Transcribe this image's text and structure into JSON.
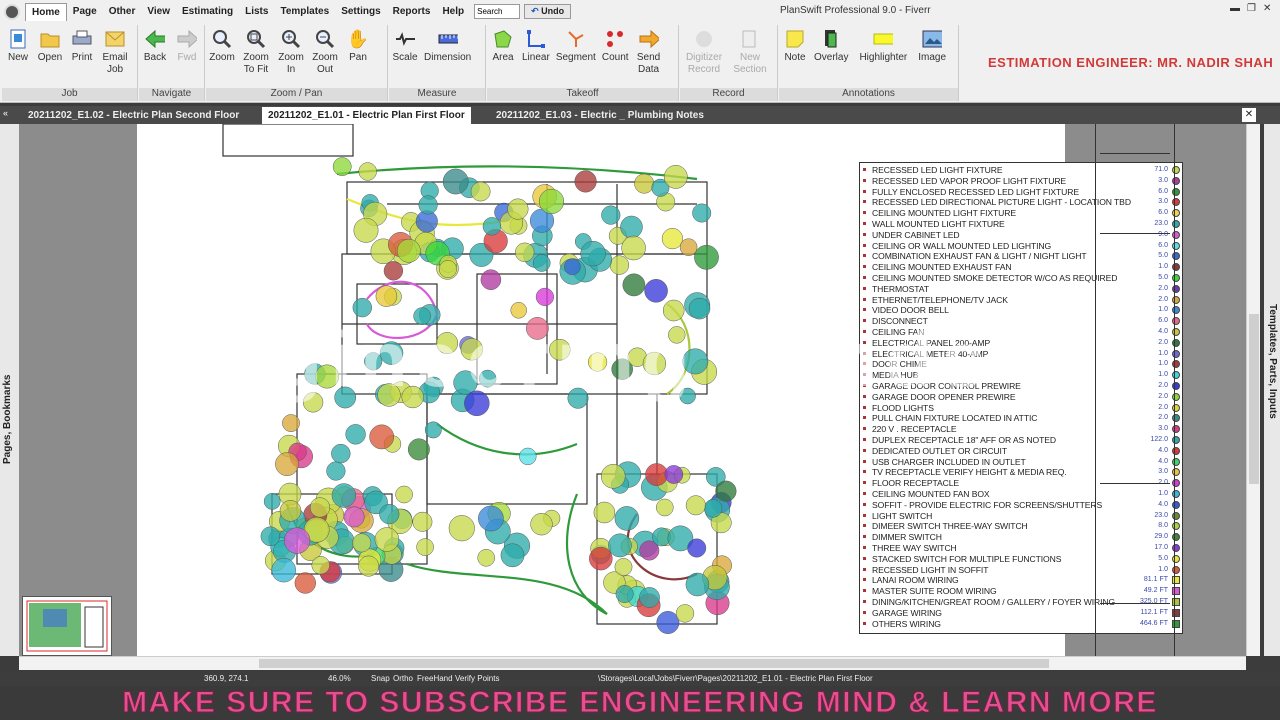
{
  "menu": {
    "items": [
      "Home",
      "Page",
      "Other",
      "View",
      "Estimating",
      "Lists",
      "Templates",
      "Settings",
      "Reports",
      "Help"
    ],
    "search_value": "Search",
    "undo_label": "Undo"
  },
  "window": {
    "title": "PlanSwift Professional 9.0 - Fiverr"
  },
  "ribbon": {
    "groups": [
      {
        "label": "Job",
        "buttons": [
          {
            "label": "New",
            "icon": "new-file-icon"
          },
          {
            "label": "Open",
            "icon": "folder-open-icon"
          },
          {
            "label": "Print",
            "icon": "printer-icon"
          },
          {
            "label": "Email Job",
            "icon": "email-icon"
          }
        ]
      },
      {
        "label": "Navigate",
        "buttons": [
          {
            "label": "Back",
            "icon": "arrow-left-icon"
          },
          {
            "label": "Fwd",
            "icon": "arrow-right-icon",
            "disabled": true
          }
        ]
      },
      {
        "label": "Zoom / Pan",
        "buttons": [
          {
            "label": "Zoom",
            "icon": "zoom-icon"
          },
          {
            "label": "Zoom To Fit",
            "icon": "zoom-fit-icon"
          },
          {
            "label": "Zoom In",
            "icon": "zoom-in-icon"
          },
          {
            "label": "Zoom Out",
            "icon": "zoom-out-icon"
          },
          {
            "label": "Pan",
            "icon": "hand-icon"
          }
        ]
      },
      {
        "label": "Measure",
        "buttons": [
          {
            "label": "Scale",
            "icon": "scale-icon"
          },
          {
            "label": "Dimension",
            "icon": "dimension-icon"
          }
        ]
      },
      {
        "label": "Takeoff",
        "buttons": [
          {
            "label": "Area",
            "icon": "area-icon"
          },
          {
            "label": "Linear",
            "icon": "linear-icon"
          },
          {
            "label": "Segment",
            "icon": "segment-icon"
          },
          {
            "label": "Count",
            "icon": "count-icon"
          },
          {
            "label": "Send Data",
            "icon": "send-data-icon"
          }
        ]
      },
      {
        "label": "Record",
        "buttons": [
          {
            "label": "Digitizer Record",
            "icon": "digitizer-icon",
            "disabled": true
          },
          {
            "label": "New Section",
            "icon": "new-section-icon",
            "disabled": true
          }
        ]
      },
      {
        "label": "Annotations",
        "buttons": [
          {
            "label": "Note",
            "icon": "note-icon"
          },
          {
            "label": "Overlay",
            "icon": "overlay-icon"
          },
          {
            "label": "Highlighter",
            "icon": "highlighter-icon"
          },
          {
            "label": "Image",
            "icon": "image-icon"
          }
        ]
      }
    ]
  },
  "engineer_label": "ESTIMATION ENGINEER: MR. NADIR SHAH",
  "tabs": [
    {
      "label": "20211202_E1.02 - Electric Plan Second Floor"
    },
    {
      "label": "20211202_E1.01 - Electric Plan First Floor",
      "active": true
    },
    {
      "label": "20211202_E1.03 - Electric _ Plumbing Notes"
    }
  ],
  "side_panels": {
    "left": "Pages, Bookmarks",
    "right": "Templates, Parts, Inputs"
  },
  "watermark": "Engineering Minds",
  "legend": [
    {
      "label": "RECESSED LED LIGHT FIXTURE",
      "count": "71.0",
      "color": "#c6d94a"
    },
    {
      "label": "RECESSED LED VAPOR PROOF LIGHT FIXTURE",
      "count": "3.0",
      "color": "#b23aa0"
    },
    {
      "label": "FULLY ENCLOSED RECESSED LED LIGHT FIXTURE",
      "count": "6.0",
      "color": "#2e9a3a"
    },
    {
      "label": "RECESSED LED DIRECTIONAL PICTURE LIGHT - LOCATION TBD",
      "count": "3.0",
      "color": "#d93a3a"
    },
    {
      "label": "CEILING MOUNTED LIGHT FIXTURE",
      "count": "6.0",
      "color": "#e8d84a"
    },
    {
      "label": "WALL MOUNTED LIGHT FIXTURE",
      "count": "23.0",
      "color": "#2eaaaa"
    },
    {
      "label": "UNDER CABINET LED",
      "count": "9.0",
      "color": "#d85ad8"
    },
    {
      "label": "CEILING OR WALL MOUNTED LED LIGHTING",
      "count": "6.0",
      "color": "#5ae0e8"
    },
    {
      "label": "COMBINATION EXHAUST FAN & LIGHT / NIGHT LIGHT",
      "count": "5.0",
      "color": "#3a6ad8"
    },
    {
      "label": "CEILING MOUNTED EXHAUST FAN",
      "count": "1.0",
      "color": "#8a3a3a"
    },
    {
      "label": "CEILING MOUNTED SMOKE DETECTOR W/CO AS REQUIRED",
      "count": "5.0",
      "color": "#3ad83a"
    },
    {
      "label": "THERMOSTAT",
      "count": "2.0",
      "color": "#6a3aa8"
    },
    {
      "label": "ETHERNET/TELEPHONE/TV JACK",
      "count": "2.0",
      "color": "#d8a83a"
    },
    {
      "label": "VIDEO DOOR BELL",
      "count": "1.0",
      "color": "#3a8ad8"
    },
    {
      "label": "DISCONNECT",
      "count": "6.0",
      "color": "#e86a8a"
    },
    {
      "label": "CEILING FAN",
      "count": "4.0",
      "color": "#c8c83a"
    },
    {
      "label": "ELECTRICAL PANEL 200-AMP",
      "count": "2.0",
      "color": "#2e7a3a"
    },
    {
      "label": "ELECTRICAL METER 40-AMP",
      "count": "1.0",
      "color": "#6a6ad8"
    },
    {
      "label": "DOOR CHIME",
      "count": "1.0",
      "color": "#a83a3a"
    },
    {
      "label": "MEDIA HUB",
      "count": "1.0",
      "color": "#3ad8d8"
    },
    {
      "label": "GARAGE DOOR CONTROL PREWIRE",
      "count": "2.0",
      "color": "#3a3ad8"
    },
    {
      "label": "GARAGE DOOR OPENER PREWIRE",
      "count": "2.0",
      "color": "#8ad83a"
    },
    {
      "label": "FLOOD LIGHTS",
      "count": "2.0",
      "color": "#d8d83a"
    },
    {
      "label": "PULL CHAIN FIXTURE LOCATED IN ATTIC",
      "count": "2.0",
      "color": "#3a8a8a"
    },
    {
      "label": "220 V . RECEPTACLE",
      "count": "3.0",
      "color": "#d83a8a"
    },
    {
      "label": "DUPLEX RECEPTACLE 18\" AFF OR AS NOTED",
      "count": "122.0",
      "color": "#2ea8a8"
    },
    {
      "label": "DEDICATED OUTLET OR CIRCUIT",
      "count": "4.0",
      "color": "#d83a3a"
    },
    {
      "label": "USB CHARGER INCLUDED IN OUTLET",
      "count": "4.0",
      "color": "#3ad86a"
    },
    {
      "label": "TV RECEPTACLE VERIFY HEIGHT & MEDIA REQ.",
      "count": "3.0",
      "color": "#e8c83a"
    },
    {
      "label": "FLOOR RECEPTACLE",
      "count": "2.0",
      "color": "#d83ad8"
    },
    {
      "label": "CEILING MOUNTED FAN BOX",
      "count": "1.0",
      "color": "#3ab8d8"
    },
    {
      "label": "SOFFIT - PROVIDE ELECTRIC FOR SCREENS/SHUTTERS",
      "count": "4.0",
      "color": "#3a5ad8"
    },
    {
      "label": "LIGHT SWITCH",
      "count": "23.0",
      "color": "#6a8a3a"
    },
    {
      "label": "DIMEER SWITCH THREE-WAY SWITCH",
      "count": "8.0",
      "color": "#a8d83a"
    },
    {
      "label": "DIMMER SWITCH",
      "count": "29.0",
      "color": "#3a8a3a"
    },
    {
      "label": "THREE WAY SWITCH",
      "count": "17.0",
      "color": "#8a3ad8"
    },
    {
      "label": "STACKED SWITCH FOR MULTIPLE FUNCTIONS",
      "count": "5.0",
      "color": "#e8e83a"
    },
    {
      "label": "RECESSED LIGHT IN SOFFIT",
      "count": "1.0",
      "color": "#d85a3a"
    },
    {
      "label": "LANAI ROOM WIRING",
      "count": "81.1 FT",
      "color": "#e8e83a",
      "square": true
    },
    {
      "label": "MASTER SUITE ROOM WIRING",
      "count": "49.2 FT",
      "color": "#d85ad8",
      "square": true
    },
    {
      "label": "DINING/KITCHEN/GREAT ROOM / GALLERY / FOYER WIRING",
      "count": "325.0 FT",
      "color": "#a8c83a",
      "square": true
    },
    {
      "label": "GARAGE WIRING",
      "count": "112.1 FT",
      "color": "#8a3a3a",
      "square": true
    },
    {
      "label": "OTHERS WIRING",
      "count": "464.6 FT",
      "color": "#2e9a3a",
      "square": true
    }
  ],
  "status": {
    "coords": "360.9, 274.1",
    "zoom": "46.0%",
    "snap": "Snap",
    "ortho": "Ortho",
    "freehand": "FreeHand",
    "verify": "Verify Points",
    "path": "\\Storages\\Local\\Jobs\\Fiverr\\Pages\\20211202_E1.01 - Electric Plan First Floor"
  },
  "banner": "MAKE SURE TO SUBSCRIBE ENGINEERING MIND & LEARN MORE"
}
